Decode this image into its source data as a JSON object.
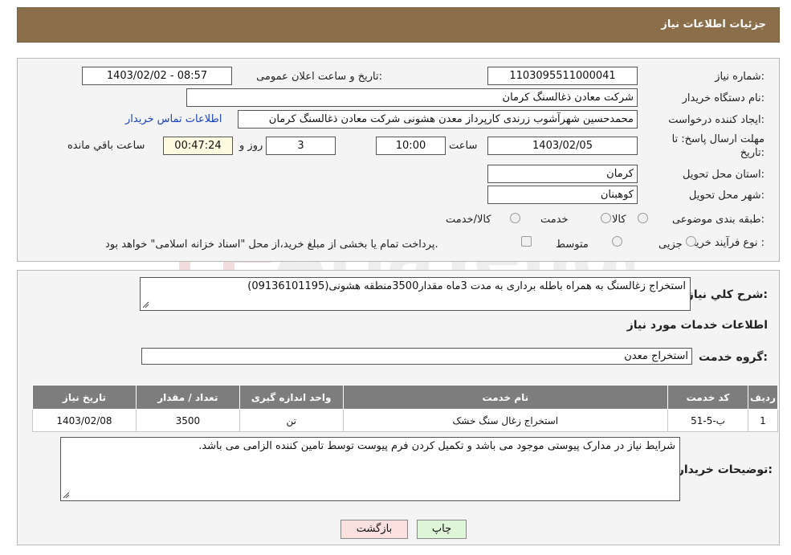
{
  "header": {
    "title": "جزئیات اطلاعات نیاز"
  },
  "fields": {
    "need_number_label": "شماره نیاز:",
    "need_number": "1103095511000041",
    "announce_label": "تاریخ و ساعت اعلان عمومی:",
    "announce_value": "1403/02/02 - 08:57",
    "buyer_label": "نام دستگاه خریدار:",
    "buyer_value": "شرکت معادن ذغالسنگ کرمان",
    "creator_label": "ایجاد کننده درخواست:",
    "creator_value": "محمدحسین شهرآشوب زرندی کارپرداز معدن هشونی شرکت معادن ذغالسنگ کرمان",
    "contact_link": "اطلاعات تماس خریدار",
    "deadline_label_1": "مهلت ارسال پاسخ: تا",
    "deadline_label_2": "تاریخ:",
    "deadline_date": "1403/02/05",
    "hour_label": "ساعت",
    "deadline_time": "10:00",
    "days_value": "3",
    "days_label": "روز و",
    "remaining_time": "00:47:24",
    "remaining_label": "ساعت باقي مانده",
    "province_label": "استان محل تحویل:",
    "province_value": "کرمان",
    "city_label": "شهر محل تحویل:",
    "city_value": "کوهبنان",
    "category_label": "طبقه بندی موضوعی:",
    "category_options": [
      "کالا",
      "خدمت",
      "کالا/خدمت"
    ],
    "purchase_label": "نوع فرآیند خرید :",
    "purchase_options": [
      "جزیی",
      "متوسط"
    ],
    "purchase_note": "پرداخت تمام یا بخشی از مبلغ خرید،از محل \"اسناد خزانه اسلامی\" خواهد بود."
  },
  "details": {
    "summary_label": "شرح کلي نياز:",
    "summary_value": "استخراج زغالسنگ به همراه باطله برداری به مدت 3ماه مقدار3500منطقه هشونی(09136101195)",
    "services_heading": "اطلاعات خدمات مورد نياز",
    "service_group_label": "گروه خدمت:",
    "service_group_value": "استخراج معدن",
    "table": {
      "headers": [
        "رديف",
        "کد خدمت",
        "نام خدمت",
        "واحد اندازه گیری",
        "تعداد / مقدار",
        "تاریخ نیاز"
      ],
      "rows": [
        [
          "1",
          "ب-5-51",
          "استخراج زغال سنگ خشک",
          "تن",
          "3500",
          "1403/02/08"
        ]
      ]
    },
    "notes_label": "توضیحات خریدار:",
    "notes_value": "شرایط نیاز در مدارک پیوستی موجود می باشد و تکمیل کردن فرم پیوست توسط تامین کننده الزامی می باشد."
  },
  "buttons": {
    "print": "چاپ",
    "back": "بازگشت"
  },
  "watermark": {
    "text": "AriaTender.neT"
  },
  "colors": {
    "header_bg": "#8b6e4a",
    "table_header_bg": "#7d7d7d",
    "link": "#1a40c0",
    "print_bg": "#dff5d8",
    "back_bg": "#fbe0e0"
  }
}
